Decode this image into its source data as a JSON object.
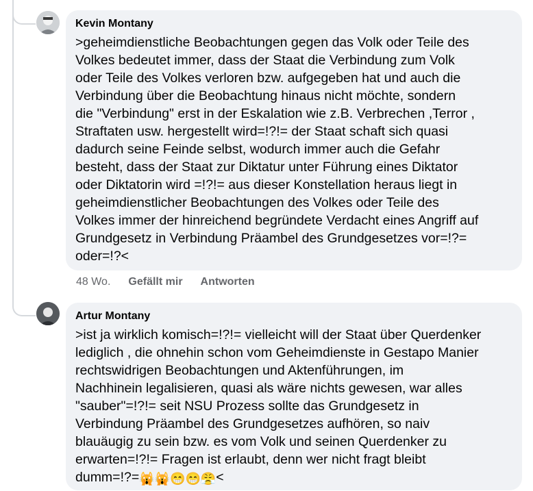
{
  "comments": [
    {
      "author": "Kevin Montany",
      "text": ">geheimdienstliche Beobachtungen gegen das Volk oder Teile des\nVolkes bedeutet immer, dass der Staat die Verbindung zum Volk\noder Teile des Volkes verloren bzw. aufgegeben hat und auch die\nVerbindung über die Beobachtung hinaus  nicht möchte, sondern\ndie \"Verbindung\" erst in der Eskalation wie z.B.  Verbrechen ,Terror ,\nStraftaten usw. hergestellt wird=!?!= der Staat schaft sich quasi\ndadurch seine Feinde selbst, wodurch immer auch die Gefahr\nbesteht, dass der Staat zur Diktatur unter Führung eines Diktator\noder Diktatorin  wird =!?!= aus dieser Konstellation heraus liegt in\ngeheimdienstlicher Beobachtungen des Volkes oder Teile des\nVolkes immer der hinreichend begründete Verdacht eines Angriff auf\nGrundgesetz in Verbindung Präambel des Grundgesetzes vor=!?=\noder=!?<",
      "time": "48 Wo.",
      "like_label": "Gefällt mir",
      "reply_label": "Antworten"
    },
    {
      "author": "Artur Montany",
      "text": ">ist ja wirklich komisch=!?!= vielleicht will der Staat über Querdenker\nlediglich , die ohnehin schon vom Geheimdienste in Gestapo Manier\nrechtswidrigen Beobachtungen und Aktenführungen,  im\nNachhinein legalisieren, quasi als wäre nichts gewesen, war alles\n\"sauber\"=!?!= seit NSU Prozess sollte das Grundgesetz in\nVerbindung Präambel des Grundgesetzes aufhören, so naiv\nblauäugig zu sein bzw. es vom Volk und seinen Querdenker zu\nerwarten=!?!= Fragen ist erlaubt, denn wer nicht fragt bleibt\ndumm=!?=",
      "emoji_tail": "🙀🙀😁😁😤",
      "text_end": "<"
    }
  ],
  "colors": {
    "bubble": "#f0f2f5",
    "meta": "#65676b",
    "thread_line": "#d6d9dd"
  }
}
